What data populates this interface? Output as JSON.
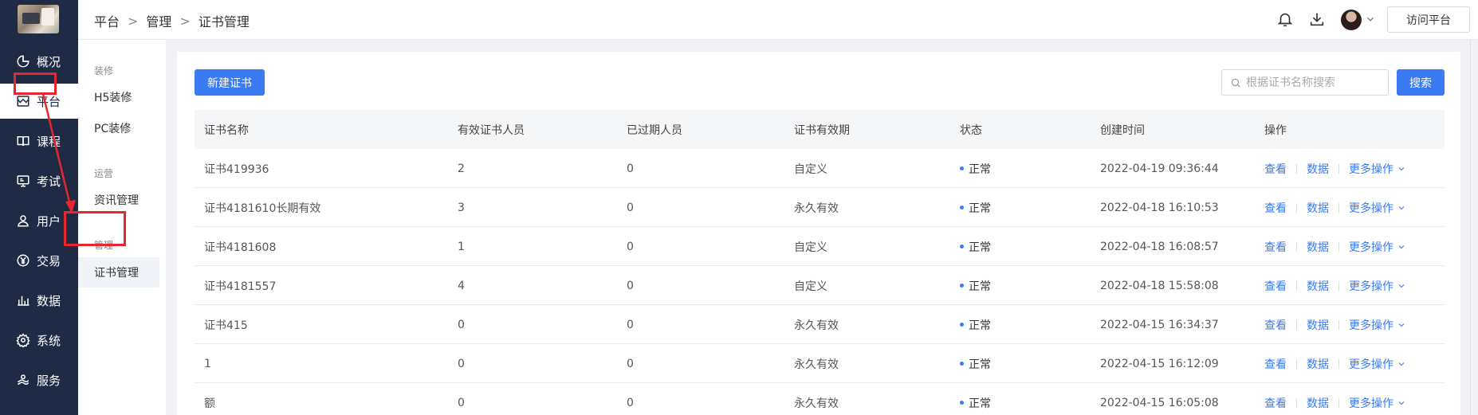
{
  "nav": {
    "items": [
      {
        "label": "概况",
        "icon": "pie-chart-icon"
      },
      {
        "label": "平台",
        "icon": "storefront-icon"
      },
      {
        "label": "课程",
        "icon": "book-icon"
      },
      {
        "label": "考试",
        "icon": "exam-icon"
      },
      {
        "label": "用户",
        "icon": "user-icon"
      },
      {
        "label": "交易",
        "icon": "yen-coin-icon"
      },
      {
        "label": "数据",
        "icon": "bar-chart-icon"
      },
      {
        "label": "系统",
        "icon": "gear-icon"
      },
      {
        "label": "服务",
        "icon": "service-icon"
      }
    ],
    "active_index": 1
  },
  "subnav": {
    "groups": [
      {
        "title": "装修",
        "items": [
          "H5装修",
          "PC装修"
        ]
      },
      {
        "title": "运营",
        "items": [
          "资讯管理"
        ]
      },
      {
        "title": "管理",
        "items": [
          "证书管理"
        ]
      }
    ],
    "active_item": "证书管理"
  },
  "header": {
    "breadcrumb": [
      "平台",
      "管理",
      "证书管理"
    ],
    "visit_label": "访问平台",
    "icons": [
      "bell-icon",
      "download-icon",
      "avatar",
      "chevron-down-icon"
    ]
  },
  "toolbar": {
    "new_label": "新建证书",
    "search_placeholder": "根据证书名称搜索",
    "search_label": "搜索"
  },
  "table": {
    "columns": [
      "证书名称",
      "有效证书人员",
      "已过期人员",
      "证书有效期",
      "状态",
      "创建时间",
      "操作"
    ],
    "rows": [
      {
        "name": "证书419936",
        "valid": "2",
        "expired": "0",
        "validity": "自定义",
        "status": "正常",
        "created": "2022-04-19 09:36:44"
      },
      {
        "name": "证书4181610长期有效",
        "valid": "3",
        "expired": "0",
        "validity": "永久有效",
        "status": "正常",
        "created": "2022-04-18 16:10:53"
      },
      {
        "name": "证书4181608",
        "valid": "1",
        "expired": "0",
        "validity": "自定义",
        "status": "正常",
        "created": "2022-04-18 16:08:57"
      },
      {
        "name": "证书4181557",
        "valid": "4",
        "expired": "0",
        "validity": "自定义",
        "status": "正常",
        "created": "2022-04-18 15:58:08"
      },
      {
        "name": "证书415",
        "valid": "0",
        "expired": "0",
        "validity": "永久有效",
        "status": "正常",
        "created": "2022-04-15 16:34:37"
      },
      {
        "name": "1",
        "valid": "0",
        "expired": "0",
        "validity": "永久有效",
        "status": "正常",
        "created": "2022-04-15 16:12:09"
      },
      {
        "name": "额",
        "valid": "0",
        "expired": "0",
        "validity": "永久有效",
        "status": "正常",
        "created": "2022-04-15 16:05:08"
      }
    ],
    "actions": {
      "view": "查看",
      "data": "数据",
      "more": "更多操作"
    },
    "status_color": "#3a7af2"
  },
  "colors": {
    "nav_bg": "#1f2a44",
    "primary": "#3a7af2",
    "annotation": "#e8262d"
  }
}
